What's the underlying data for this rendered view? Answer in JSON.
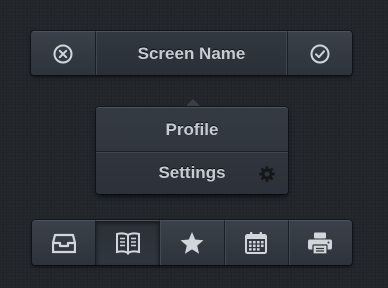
{
  "header": {
    "title": "Screen Name",
    "cancel_icon": "close-circle-icon",
    "confirm_icon": "check-circle-icon"
  },
  "menu": {
    "items": [
      {
        "label": "Profile"
      },
      {
        "label": "Settings",
        "icon": "gear-icon"
      }
    ]
  },
  "toolbar": {
    "items": [
      {
        "icon": "inbox-icon"
      },
      {
        "icon": "book-icon",
        "active": true
      },
      {
        "icon": "star-icon"
      },
      {
        "icon": "calendar-icon"
      },
      {
        "icon": "printer-icon"
      }
    ]
  },
  "colors": {
    "icon": "#d2d6db",
    "text": "#c7ccd3",
    "background": "#22262b"
  }
}
